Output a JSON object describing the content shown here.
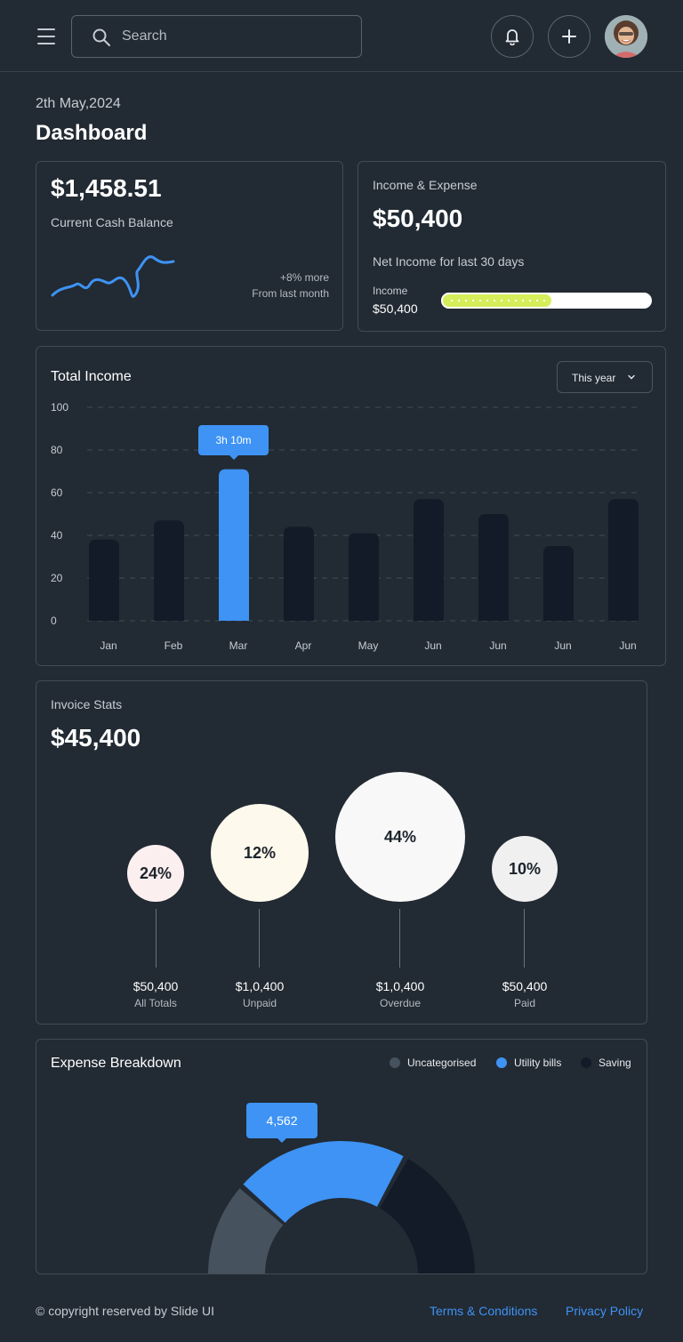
{
  "header": {
    "search_placeholder": "Search",
    "icons": [
      "menu-icon",
      "search-icon",
      "bell-icon",
      "plus-icon",
      "avatar"
    ]
  },
  "page": {
    "date": "2th May,2024",
    "title": "Dashboard"
  },
  "cash_card": {
    "amount": "$1,458.51",
    "label": "Current Cash Balance",
    "change": "+8% more",
    "change_sub": "From last month",
    "accent": "#3e93f4"
  },
  "income_card": {
    "label": "Income & Expense",
    "amount": "$50,400",
    "subtitle": "Net Income for last 30 days",
    "bar_label": "Income",
    "bar_value": "$50,400",
    "progress": 0.53,
    "bar_color": "#d6ee5a"
  },
  "total_income": {
    "title": "Total Income",
    "filter": "This year",
    "tooltip": "3h 10m"
  },
  "chart_data": {
    "type": "bar",
    "categories": [
      "Jan",
      "Feb",
      "Mar",
      "Apr",
      "May",
      "Jun",
      "Jun",
      "Jun",
      "Jun"
    ],
    "values": [
      38,
      47,
      71,
      44,
      41,
      57,
      50,
      35,
      57
    ],
    "highlight_index": 2,
    "yticks": [
      0,
      20,
      40,
      60,
      80,
      100
    ],
    "ylim": [
      0,
      100
    ],
    "grid": true,
    "colors": {
      "bar": "#141b28",
      "highlight": "#3e93f4"
    }
  },
  "invoice": {
    "label": "Invoice Stats",
    "amount": "$45,400",
    "items": [
      {
        "percent": "24%",
        "value": "$50,400",
        "label": "All Totals",
        "color": "#fcefef"
      },
      {
        "percent": "12%",
        "value": "$1,0,400",
        "label": "Unpaid",
        "color": "#fdf9ec"
      },
      {
        "percent": "44%",
        "value": "$1,0,400",
        "label": "Overdue",
        "color": "#f8f8f8"
      },
      {
        "percent": "10%",
        "value": "$50,400",
        "label": "Paid",
        "color": "#f0f0f0"
      }
    ]
  },
  "expense": {
    "title": "Expense Breakdown",
    "legend": [
      {
        "label": "Uncategorised",
        "color": "#46525d"
      },
      {
        "label": "Utility bills",
        "color": "#3e93f4"
      },
      {
        "label": "Saving",
        "color": "#141b28"
      }
    ],
    "tooltip": "4,562",
    "shares": [
      0.23,
      0.43,
      0.34
    ]
  },
  "footer": {
    "copyright": "© copyright reserved by Slide UI",
    "terms": "Terms & Conditions",
    "privacy": "Privacy Policy"
  }
}
